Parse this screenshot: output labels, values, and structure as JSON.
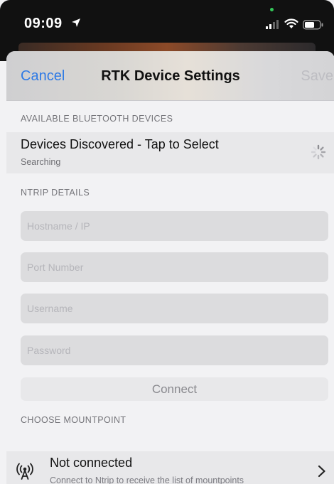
{
  "status_bar": {
    "time": "09:09"
  },
  "navbar": {
    "cancel_label": "Cancel",
    "title": "RTK Device Settings",
    "save_label": "Save"
  },
  "bluetooth": {
    "section_header": "AVAILABLE BLUETOOTH DEVICES",
    "row_title": "Devices Discovered - Tap to Select",
    "row_status": "Searching"
  },
  "ntrip": {
    "section_header": "NTRIP DETAILS",
    "hostname_placeholder": "Hostname / IP",
    "hostname_value": "",
    "port_placeholder": "Port Number",
    "port_value": "",
    "username_placeholder": "Username",
    "username_value": "",
    "password_placeholder": "Password",
    "password_value": "",
    "connect_label": "Connect"
  },
  "mountpoint": {
    "section_header": "CHOOSE MOUNTPOINT",
    "row_title": "Not connected",
    "row_subtitle": "Connect to Ntrip to receive the list of mountpoints"
  },
  "colors": {
    "accent": "#2f7ae5",
    "disabled": "#bdbdc2",
    "background": "#f2f2f4"
  },
  "icons": [
    "location-arrow-icon",
    "signal-icon",
    "wifi-icon",
    "battery-icon",
    "spinner-icon",
    "antenna-icon",
    "chevron-right-icon"
  ]
}
